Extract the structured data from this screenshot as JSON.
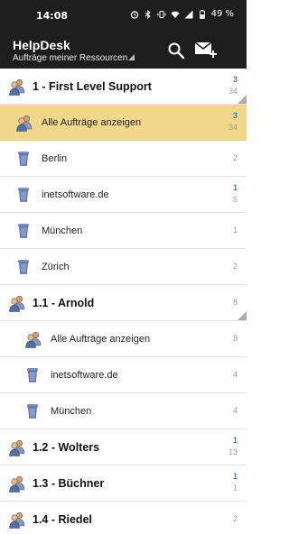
{
  "status_bar": {
    "time": "14:08",
    "battery": "49 %"
  },
  "app_bar": {
    "title": "HelpDesk",
    "subtitle": "Aufträge meiner Ressourcen",
    "icons": [
      "search-icon",
      "new-mail-icon"
    ]
  },
  "colors": {
    "bar_bg": "#1e1e1e",
    "selected_bg": "#f0d78c",
    "count_highlight": "#3b7fd1",
    "count_muted": "#9e9e9e"
  },
  "rows": [
    {
      "label": "1 - First Level Support",
      "type": "group",
      "counts": [
        "3",
        "34"
      ]
    },
    {
      "label": "Alle Aufträge anzeigen",
      "type": "all",
      "counts": [
        "3",
        "34"
      ],
      "selected": true
    },
    {
      "label": "Berlin",
      "type": "location",
      "counts": [
        "2"
      ]
    },
    {
      "label": "inetsoftware.de",
      "type": "location",
      "counts": [
        "1",
        "5"
      ]
    },
    {
      "label": "München",
      "type": "location",
      "counts": [
        "1"
      ]
    },
    {
      "label": "Zürich",
      "type": "location",
      "counts": [
        "2"
      ]
    },
    {
      "label": "1.1 - Arnold",
      "type": "group",
      "counts": [
        "8"
      ]
    },
    {
      "label": "Alle Aufträge anzeigen",
      "type": "all",
      "counts": [
        "8"
      ]
    },
    {
      "label": "inetsoftware.de",
      "type": "location",
      "counts": [
        "4"
      ]
    },
    {
      "label": "München",
      "type": "location",
      "counts": [
        "4"
      ]
    },
    {
      "label": "1.2 - Wolters",
      "type": "group",
      "counts": [
        "1",
        "13"
      ]
    },
    {
      "label": "1.3 - Büchner",
      "type": "group",
      "counts": [
        "1",
        "1"
      ]
    },
    {
      "label": "1.4 - Riedel",
      "type": "group",
      "counts": [
        "2"
      ]
    }
  ]
}
